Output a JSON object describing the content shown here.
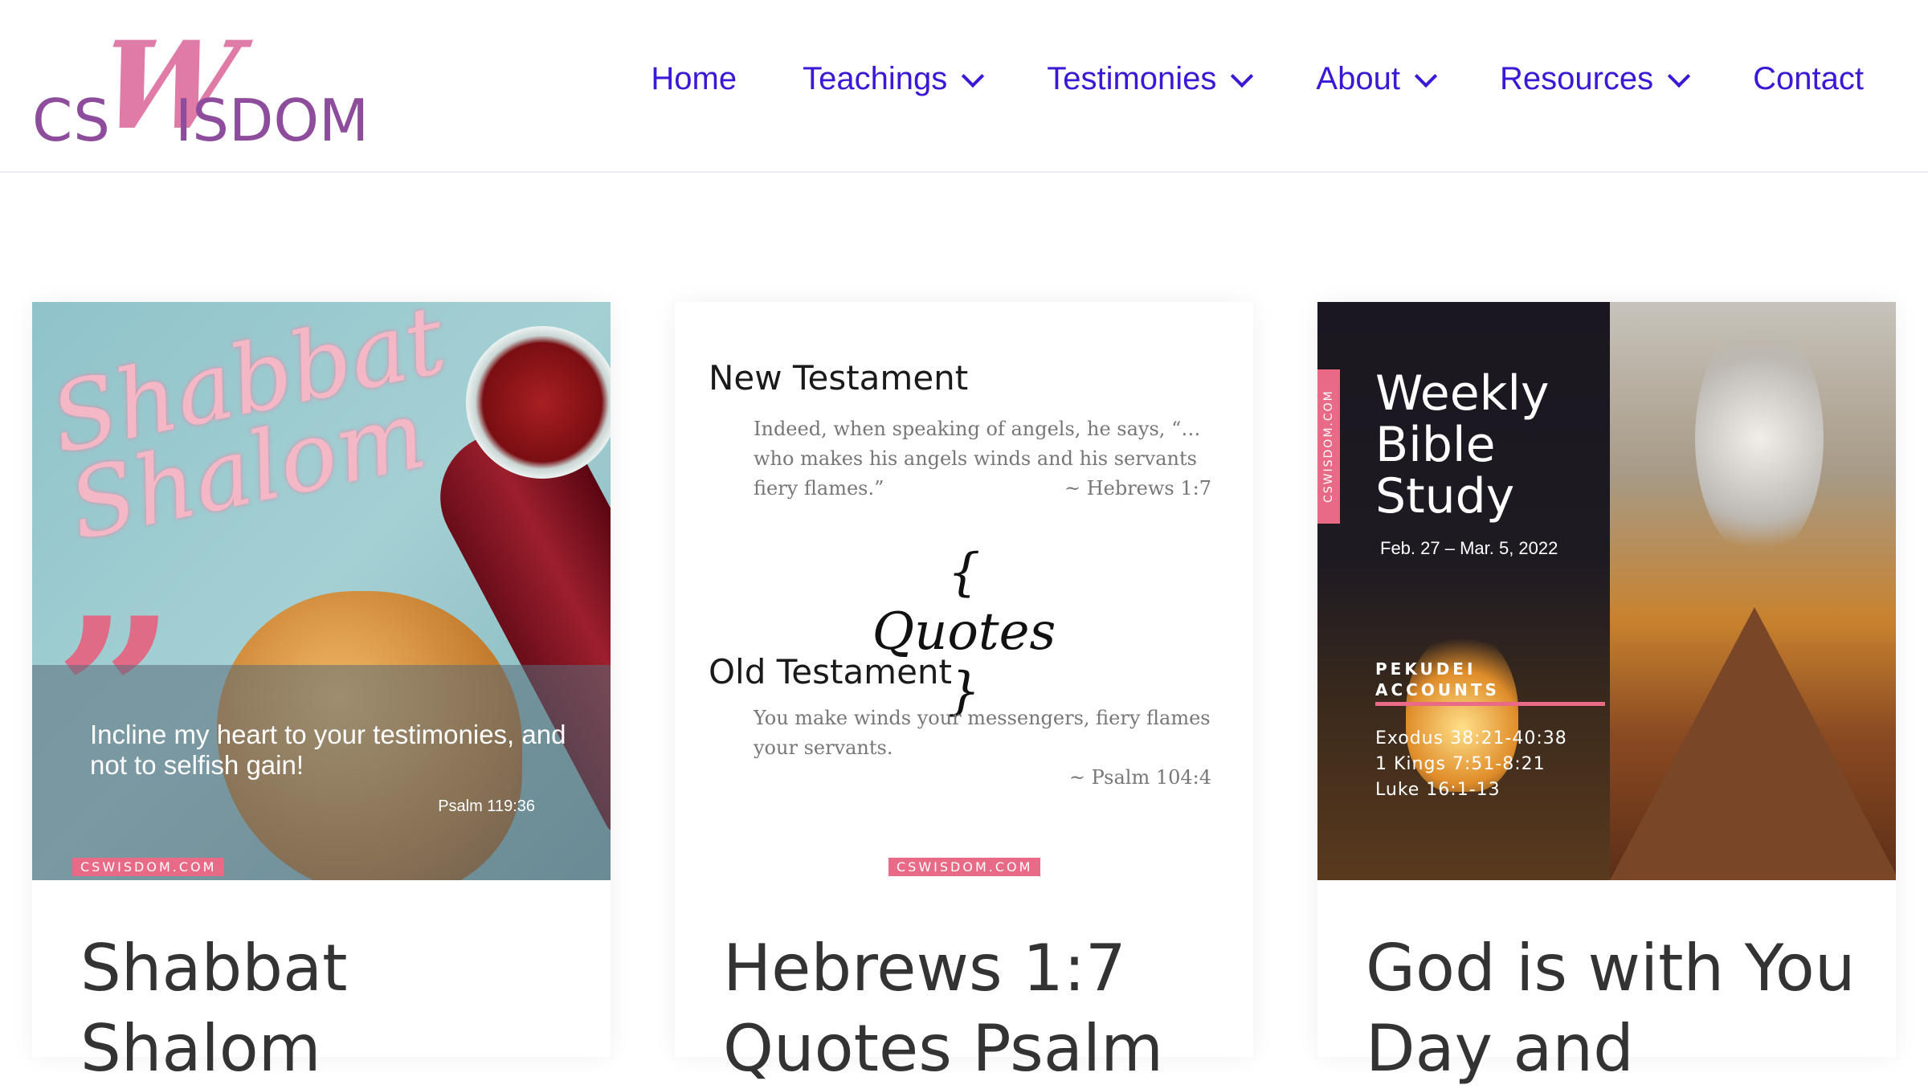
{
  "header": {
    "logo": {
      "part1": "CS",
      "part2": "W",
      "part3": "ISDOM"
    },
    "nav": [
      {
        "label": "Home",
        "has_dropdown": false
      },
      {
        "label": "Teachings",
        "has_dropdown": true
      },
      {
        "label": "Testimonies",
        "has_dropdown": true
      },
      {
        "label": "About",
        "has_dropdown": true
      },
      {
        "label": "Resources",
        "has_dropdown": true
      },
      {
        "label": "Contact",
        "has_dropdown": false
      }
    ],
    "nav_color": "#3b18d6"
  },
  "cards": [
    {
      "title": "Shabbat Shalom",
      "image": {
        "script": "Shabbat Shalom",
        "quote_mark": "”",
        "verse": "Incline my heart to your testimonies, and not to selfish gain!",
        "reference": "Psalm 119:36",
        "site": "CSWISDOM.COM"
      }
    },
    {
      "title": "Hebrews 1:7 Quotes Psalm",
      "image": {
        "heading1": "New Testament",
        "text1": "Indeed, when speaking of angels, he says, “…who makes his angels winds and his servants fiery flames.”",
        "ref1": "~ Hebrews 1:7",
        "quotes": "{ Quotes }",
        "heading2": "Old Testament",
        "text2": "You make winds your messengers, fiery flames your servants.",
        "ref2": "~ Psalm 104:4",
        "site": "CSWISDOM.COM"
      }
    },
    {
      "title": "God is with You Day and",
      "image": {
        "vertical_tag": "CSWISDOM.COM",
        "study_title": "Weekly Bible Study",
        "dates": "Feb. 27 – Mar. 5, 2022",
        "parasha": "PEKUDEI ACCOUNTS",
        "readings": [
          "Exodus 38:21-40:38",
          "1 Kings 7:51-8:21",
          "Luke 16:1-13"
        ]
      }
    }
  ],
  "accent_pink": "#e86a86"
}
